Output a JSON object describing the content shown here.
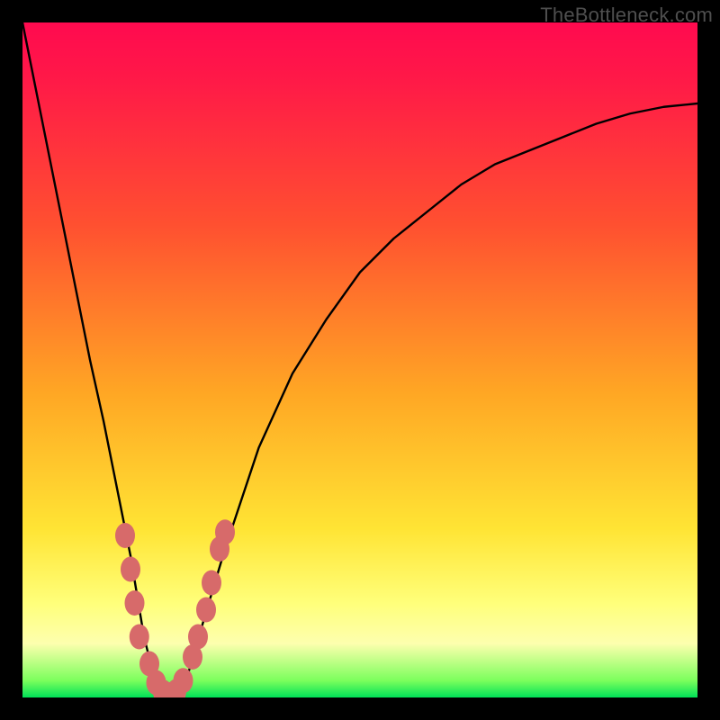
{
  "watermark": "TheBottleneck.com",
  "chart_data": {
    "type": "line",
    "title": "",
    "xlabel": "",
    "ylabel": "",
    "xlim": [
      0,
      100
    ],
    "ylim": [
      0,
      100
    ],
    "grid": false,
    "legend": false,
    "series": [
      {
        "name": "bottleneck-curve",
        "x": [
          0,
          2,
          4,
          6,
          8,
          10,
          12,
          14,
          15,
          16,
          17,
          18,
          19,
          20,
          21,
          22,
          23,
          24,
          25,
          27,
          30,
          35,
          40,
          45,
          50,
          55,
          60,
          65,
          70,
          75,
          80,
          85,
          90,
          95,
          100
        ],
        "y": [
          100,
          90,
          80,
          70,
          60,
          50,
          41,
          31,
          26,
          21,
          15,
          9,
          5,
          2,
          0.5,
          0,
          0.5,
          2,
          5,
          12,
          22,
          37,
          48,
          56,
          63,
          68,
          72,
          76,
          79,
          81,
          83,
          85,
          86.5,
          87.5,
          88
        ]
      }
    ],
    "markers": {
      "name": "highlight-points",
      "color": "#d76a6a",
      "points": [
        {
          "x": 15.2,
          "y": 24
        },
        {
          "x": 16.0,
          "y": 19
        },
        {
          "x": 16.6,
          "y": 14
        },
        {
          "x": 17.3,
          "y": 9
        },
        {
          "x": 18.8,
          "y": 5
        },
        {
          "x": 19.8,
          "y": 2.2
        },
        {
          "x": 20.8,
          "y": 0.8
        },
        {
          "x": 21.8,
          "y": 0.4
        },
        {
          "x": 22.8,
          "y": 0.9
        },
        {
          "x": 23.8,
          "y": 2.5
        },
        {
          "x": 25.2,
          "y": 6
        },
        {
          "x": 26.0,
          "y": 9
        },
        {
          "x": 27.2,
          "y": 13
        },
        {
          "x": 28.0,
          "y": 17
        },
        {
          "x": 29.2,
          "y": 22
        },
        {
          "x": 30.0,
          "y": 24.5
        }
      ]
    },
    "gradient_stops": [
      {
        "pos": 0.0,
        "color": "#ff0a4f"
      },
      {
        "pos": 0.3,
        "color": "#ff5030"
      },
      {
        "pos": 0.55,
        "color": "#ffa724"
      },
      {
        "pos": 0.75,
        "color": "#ffe434"
      },
      {
        "pos": 0.92,
        "color": "#fdffae"
      },
      {
        "pos": 1.0,
        "color": "#00e158"
      }
    ]
  }
}
